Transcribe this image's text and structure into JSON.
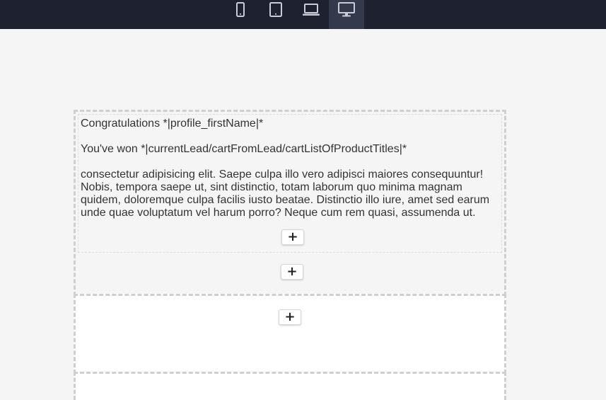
{
  "toolbar": {
    "devices": [
      {
        "name": "mobile",
        "icon": "mobile-icon",
        "active": false
      },
      {
        "name": "tablet",
        "icon": "tablet-icon",
        "active": false
      },
      {
        "name": "laptop",
        "icon": "laptop-icon",
        "active": false
      },
      {
        "name": "desktop",
        "icon": "desktop-icon",
        "active": true
      }
    ]
  },
  "email": {
    "greeting": "Congratulations *|profile_firstName|*",
    "won_line": "You've won *|currentLead/cartFromLead/cartListOfProductTitles|*",
    "body": "consectetur adipisicing elit. Saepe culpa illo vero adipisci maiores consequuntur! Nobis, tempora saepe ut, sint distinctio, totam laborum quo minima magnam quidem, doloremque culpa facilis iusto beatae. Distinctio illo iure, amet sed earum unde quae voluptatum vel harum porro? Neque cum rem quasi, assumenda ut."
  },
  "add_button_label": "+"
}
